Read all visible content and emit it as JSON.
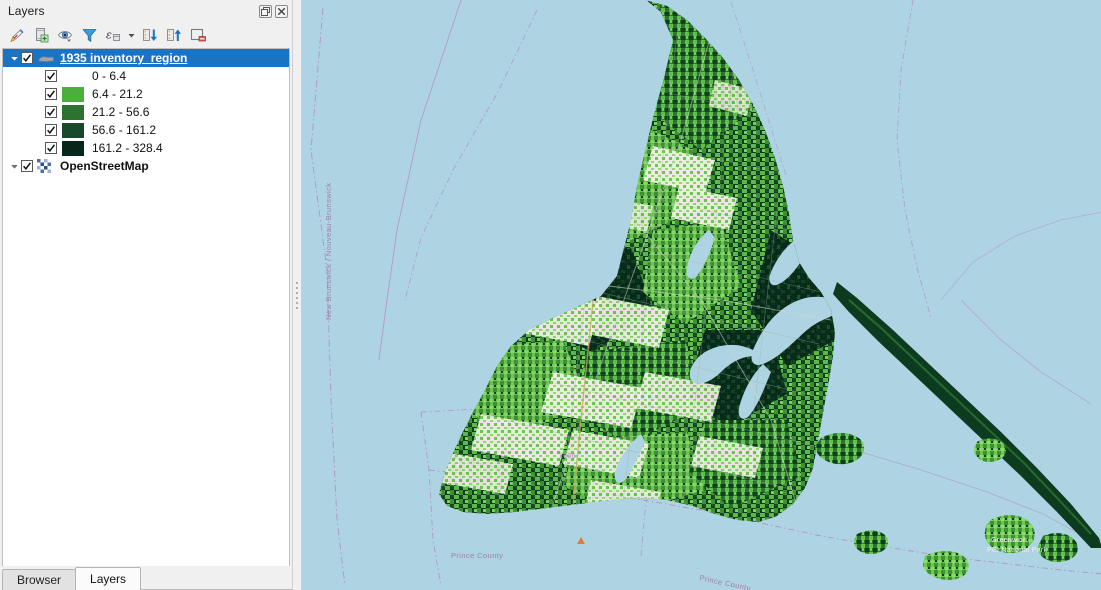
{
  "panel": {
    "title": "Layers",
    "titlebar_buttons": [
      {
        "name": "float-panel-button",
        "label": "Float"
      },
      {
        "name": "close-panel-button",
        "label": "Close"
      }
    ],
    "toolbar": [
      {
        "name": "open-layer-styling-button",
        "label": "Open the Layer Styling panel"
      },
      {
        "name": "add-group-button",
        "label": "Add Group"
      },
      {
        "name": "manage-layer-visibility-button",
        "label": "Manage Map Themes"
      },
      {
        "name": "filter-legend-button",
        "label": "Filter Legend"
      },
      {
        "name": "filter-legend-expression-button",
        "label": "Filter Legend by Expression"
      },
      {
        "name": "collapse-all-button",
        "label": "Collapse All"
      },
      {
        "name": "expand-all-button",
        "label": "Expand All"
      },
      {
        "name": "remove-layer-button",
        "label": "Remove Layer/Group"
      }
    ]
  },
  "layers": [
    {
      "name": "1935 inventory_region",
      "checked": true,
      "selected": true,
      "expanded": true,
      "icon": "polygon-layer-icon",
      "legend": [
        {
          "label": "0 - 6.4",
          "color": "#63c council",
          "checked": true
        },
        {
          "label": "6.4 - 21.2",
          "color": "#4caf3c",
          "checked": true
        },
        {
          "label": "21.2 - 56.6",
          "color": "#2e7230",
          "checked": true
        },
        {
          "label": "56.6 - 161.2",
          "color": "#17492a",
          "checked": true
        },
        {
          "label": "161.2 - 328.4",
          "color": "#06271a",
          "checked": true
        }
      ]
    },
    {
      "name": "OpenStreetMap",
      "checked": true,
      "selected": false,
      "expanded": true,
      "icon": "raster-layer-icon",
      "legend": []
    }
  ],
  "legend_colors": [
    "#6ac council",
    "#4caf3c",
    "#2e7230",
    "#17492a",
    "#06271a"
  ],
  "tabs": [
    {
      "label": "Browser",
      "active": false
    },
    {
      "label": "Layers",
      "active": true
    }
  ],
  "map": {
    "background_color": "#aed3e3",
    "land_label_province": "New Brunswick / Nouveau-Brunswick",
    "county_label_a": "Prince County",
    "county_label_b": "Prince County",
    "park_label": "Greenwich\nPEI National Park",
    "road_label": "1606"
  },
  "colors": {
    "selection_blue": "#1b73c4",
    "water": "#aed3e3",
    "boundary": "#b08ab8",
    "panel_bg": "#f0f0f0",
    "tree_bg": "#ffffff"
  }
}
